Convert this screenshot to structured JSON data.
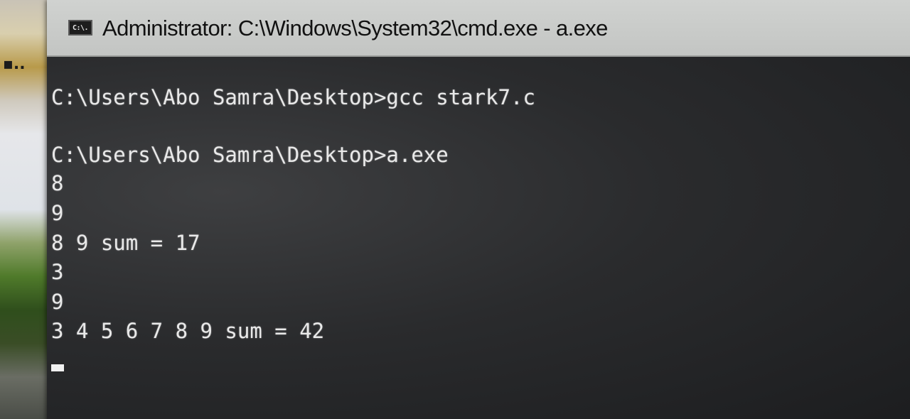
{
  "window": {
    "title": "Administrator: C:\\Windows\\System32\\cmd.exe - a.exe",
    "icon": "cmd-console-icon",
    "icon_text": "C:\\."
  },
  "terminal": {
    "lines": [
      "C:\\Users\\Abo Samra\\Desktop>gcc stark7.c",
      "",
      "C:\\Users\\Abo Samra\\Desktop>a.exe",
      "8",
      "9",
      "8 9 sum = 17",
      "3",
      "9",
      "3 4 5 6 7 8 9 sum = 42"
    ]
  },
  "colors": {
    "console_background": "#2a2b2d",
    "console_text": "#e9e9e9",
    "titlebar": "#c8cac8"
  }
}
